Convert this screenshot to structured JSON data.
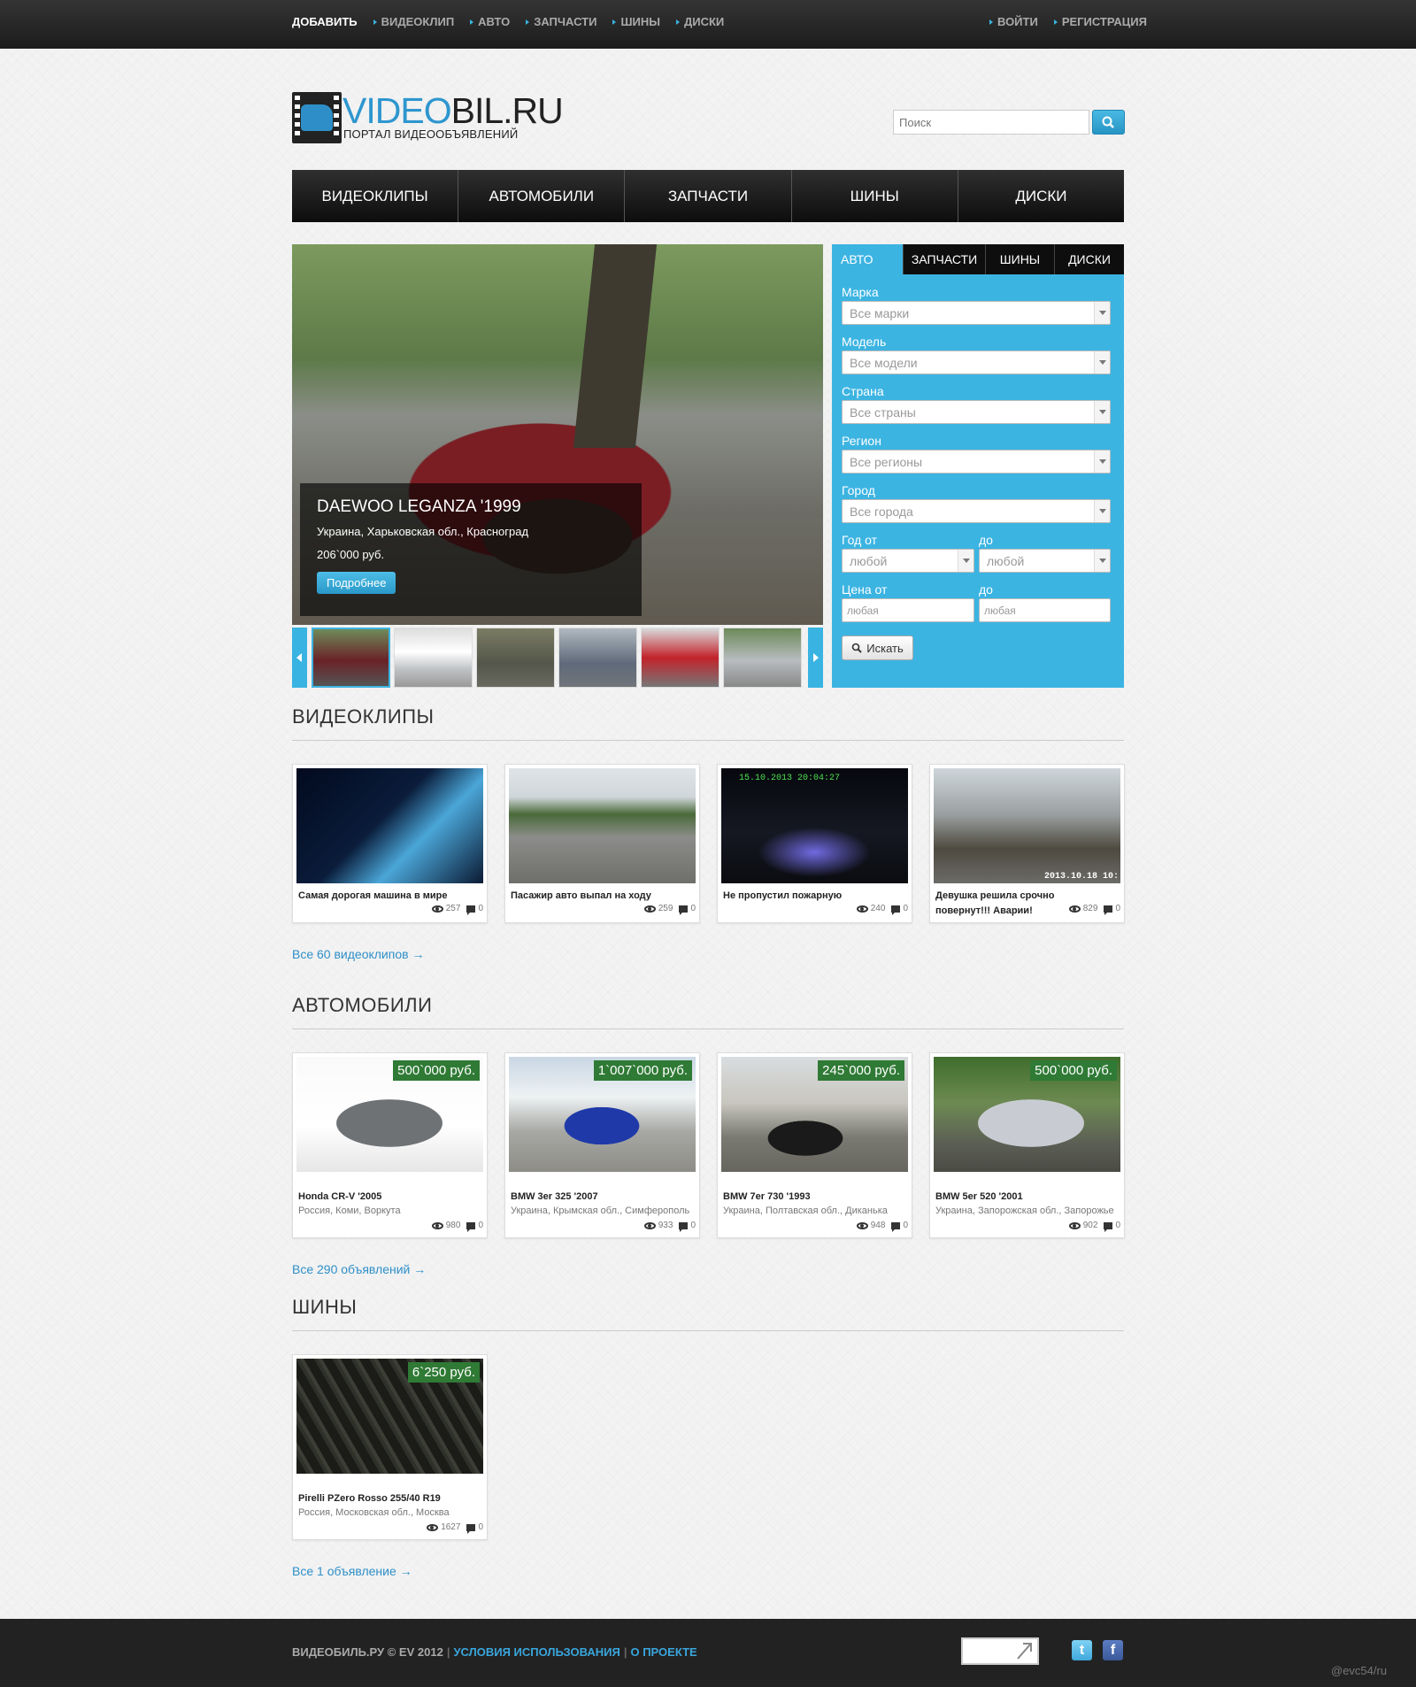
{
  "topbar": {
    "links": [
      "ДОБАВИТЬ",
      "ВИДЕОКЛИП",
      "АВТО",
      "ЗАПЧАСТИ",
      "ШИНЫ",
      "ДИСКИ"
    ],
    "right": [
      "ВОЙТИ",
      "РЕГИСТРАЦИЯ"
    ]
  },
  "logo": {
    "name_a": "VIDEO",
    "name_b": "BIL",
    "name_c": ".RU",
    "subtitle": "ПОРТАЛ ВИДЕООБЪЯВЛЕНИЙ"
  },
  "search": {
    "placeholder": "Поиск",
    "icon": "search-icon"
  },
  "nav": [
    "ВИДЕОКЛИПЫ",
    "АВТОМОБИЛИ",
    "ЗАПЧАСТИ",
    "ШИНЫ",
    "ДИСКИ"
  ],
  "slide": {
    "title": "DAEWOO LEGANZA '1999",
    "location": "Украина, Харьковская обл., Красноград",
    "price": "206`000 руб.",
    "more": "Подробнее"
  },
  "filter": {
    "tabs": [
      "АВТО",
      "ЗАПЧАСТИ",
      "ШИНЫ",
      "ДИСКИ"
    ],
    "fields": [
      {
        "label": "Марка",
        "value": "Все марки"
      },
      {
        "label": "Модель",
        "value": "Все модели"
      },
      {
        "label": "Страна",
        "value": "Все страны"
      },
      {
        "label": "Регион",
        "value": "Все регионы"
      },
      {
        "label": "Город",
        "value": "Все города"
      }
    ],
    "year_from_label": "Год от",
    "year_to_label": "до",
    "year_from": "любой",
    "year_to": "любой",
    "price_from_label": "Цена от",
    "price_to_label": "до",
    "price_from": "любая",
    "price_to": "любая",
    "button": "Искать"
  },
  "videos": {
    "title": "ВИДЕОКЛИПЫ",
    "all": "Все 60 видеоклипов →",
    "items": [
      {
        "title": "Самая дорогая машина в мире",
        "views": "257",
        "comments": "0"
      },
      {
        "title": "Пасажир авто выпал на ходу",
        "views": "259",
        "comments": "0"
      },
      {
        "title": "Не пропустил пожарную",
        "views": "240",
        "comments": "0",
        "stamp": "15.10.2013  20:04:27"
      },
      {
        "title": "Девушка решила срочно повернут!!! Аварии!",
        "views": "829",
        "comments": "0",
        "stamp": "2013.10.18 10:"
      }
    ]
  },
  "cars": {
    "title": "АВТОМОБИЛИ",
    "all": "Все 290 объявлений →",
    "items": [
      {
        "title": "Honda CR-V '2005",
        "location": "Россия, Коми, Воркута",
        "price": "500`000 руб.",
        "views": "980",
        "comments": "0"
      },
      {
        "title": "BMW 3er 325 '2007",
        "location": "Украина, Крымская обл., Симферополь",
        "price": "1`007`000 руб.",
        "views": "933",
        "comments": "0"
      },
      {
        "title": "BMW 7er 730 '1993",
        "location": "Украина, Полтавская обл., Диканька",
        "price": "245`000 руб.",
        "views": "948",
        "comments": "0"
      },
      {
        "title": "BMW 5er 520 '2001",
        "location": "Украина, Запорожская обл., Запорожье",
        "price": "500`000 руб.",
        "views": "902",
        "comments": "0"
      }
    ]
  },
  "tires": {
    "title": "ШИНЫ",
    "all": "Все 1 объявление →",
    "items": [
      {
        "title": "Pirelli PZero Rosso 255/40 R19",
        "location": "Россия, Московская обл., Москва",
        "price": "6`250 руб.",
        "views": "1627",
        "comments": "0"
      }
    ]
  },
  "footer": {
    "copy": "ВИДЕОБИЛЬ.РУ © EV 2012",
    "terms": "УСЛОВИЯ ИСПОЛЬЗОВАНИЯ",
    "about": "О ПРОЕКТЕ",
    "watermark": "@evc54/ru"
  },
  "colors": {
    "accent": "#3cb4e2",
    "dark": "#1c1c1c",
    "price": "#2f7a35"
  }
}
